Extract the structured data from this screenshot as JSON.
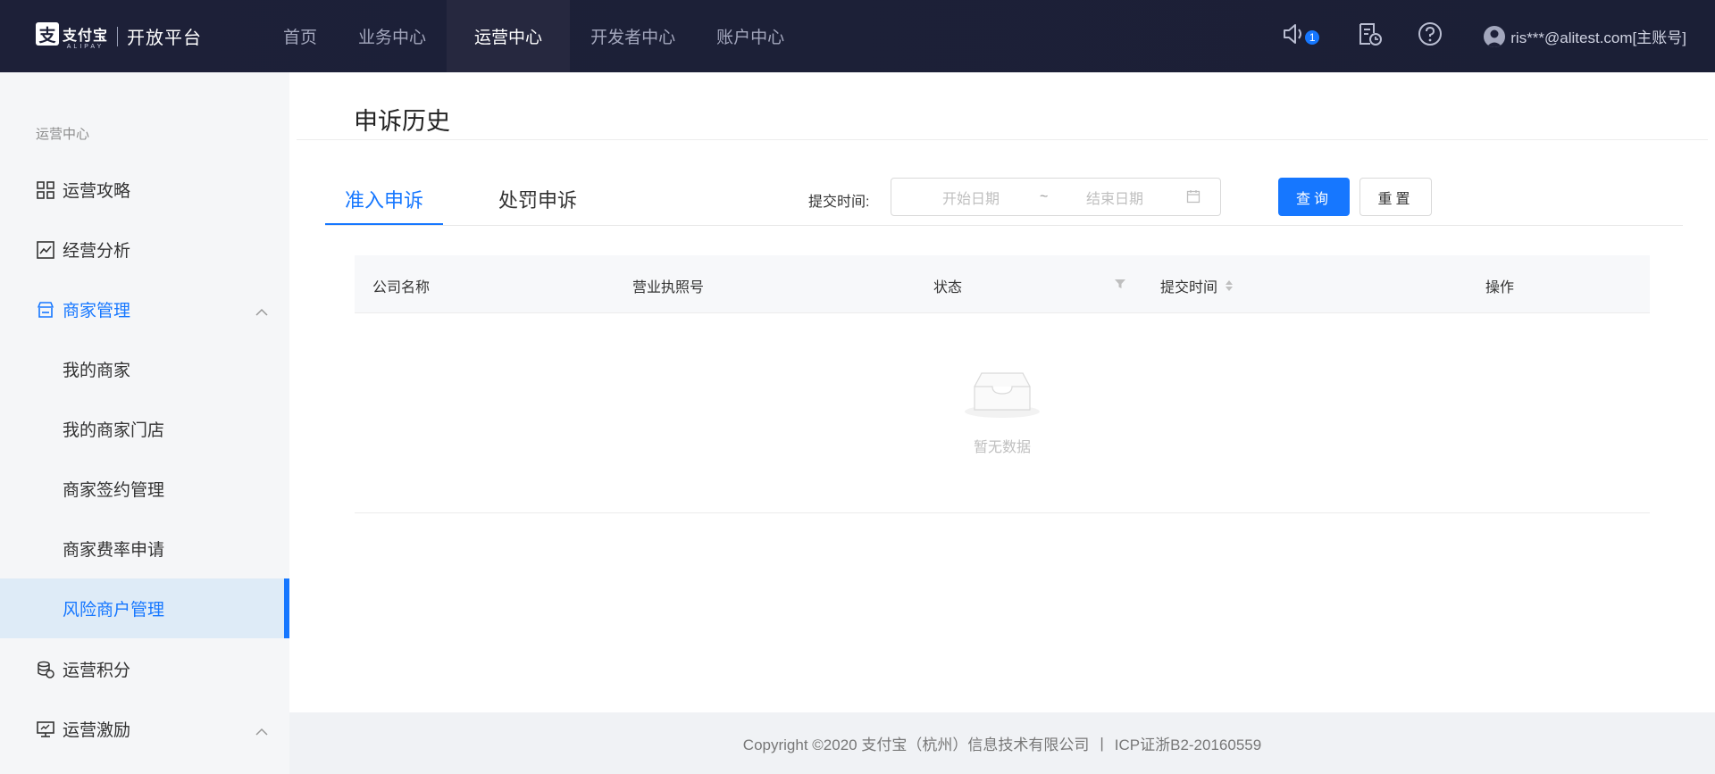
{
  "brand": {
    "logo_cn": "支付宝",
    "logo_en": "ALIPAY",
    "name": "开放平台"
  },
  "nav": {
    "items": [
      {
        "label": "首页"
      },
      {
        "label": "业务中心"
      },
      {
        "label": "运营中心"
      },
      {
        "label": "开发者中心"
      },
      {
        "label": "账户中心"
      }
    ],
    "active": "运营中心"
  },
  "header": {
    "notice_count": "1",
    "user": "ris***@alitest.com[主账号]"
  },
  "sidebar": {
    "section_title": "运营中心",
    "items": [
      {
        "label": "运营攻略",
        "icon": "grid-icon"
      },
      {
        "label": "经营分析",
        "icon": "chart-icon"
      },
      {
        "label": "商家管理",
        "icon": "store-icon"
      },
      {
        "label": "我的商家"
      },
      {
        "label": "我的商家门店"
      },
      {
        "label": "商家签约管理"
      },
      {
        "label": "商家费率申请"
      },
      {
        "label": "风险商户管理"
      },
      {
        "label": "运营积分",
        "icon": "coins-icon"
      },
      {
        "label": "运营激励",
        "icon": "monitor-icon"
      }
    ]
  },
  "page": {
    "title": "申诉历史",
    "tabs": [
      {
        "label": "准入申诉"
      },
      {
        "label": "处罚申诉"
      }
    ],
    "filter": {
      "label": "提交时间:",
      "start_placeholder": "开始日期",
      "separator": "~",
      "end_placeholder": "结束日期"
    },
    "buttons": {
      "query": "查询",
      "reset": "重置"
    },
    "table": {
      "columns": [
        {
          "label": "公司名称"
        },
        {
          "label": "营业执照号"
        },
        {
          "label": "状态"
        },
        {
          "label": "提交时间"
        },
        {
          "label": "操作"
        }
      ],
      "empty_text": "暂无数据"
    }
  },
  "footer": {
    "copyright": "Copyright ©2020 支付宝（杭州）信息技术有限公司",
    "separator": "|",
    "icp": "ICP证浙B2-20160559"
  },
  "colors": {
    "accent": "#1677ff",
    "header_bg": "#1d2038",
    "sidebar_bg": "#f5f6f8",
    "sidebar_selected_bg": "#deebf7"
  }
}
